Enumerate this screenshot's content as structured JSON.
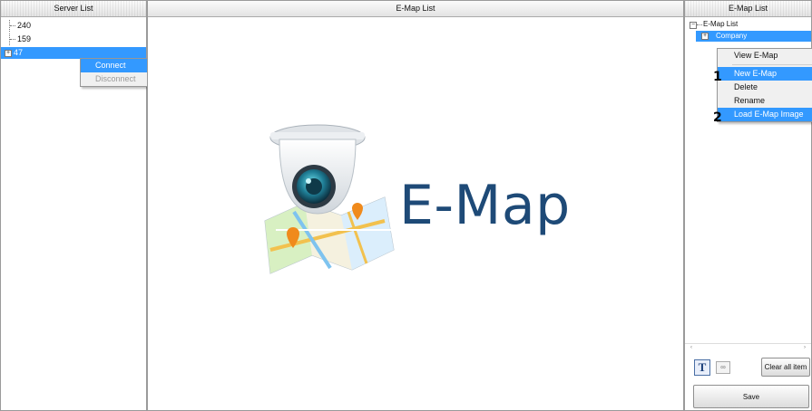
{
  "server_list": {
    "title": "Server List",
    "items": [
      {
        "label": "240"
      },
      {
        "label": "159"
      },
      {
        "label": "47",
        "selected": true
      }
    ],
    "context_menu": [
      "Connect",
      "Disconnect"
    ]
  },
  "center": {
    "title": "E-Map List",
    "logo_text": "E-Map"
  },
  "emap_panel": {
    "title": "E-Map List",
    "root_label": "E-Map List",
    "child_label": "Company",
    "context_menu": [
      "View E-Map",
      "New E-Map",
      "Delete",
      "Rename",
      "Load E-Map Image"
    ],
    "markers": [
      "1",
      "2"
    ],
    "text_tool": "T",
    "clear_label": "Clear all item",
    "save_label": "Save"
  },
  "colors": {
    "selection": "#3399ff",
    "logo": "#1e4a77"
  }
}
